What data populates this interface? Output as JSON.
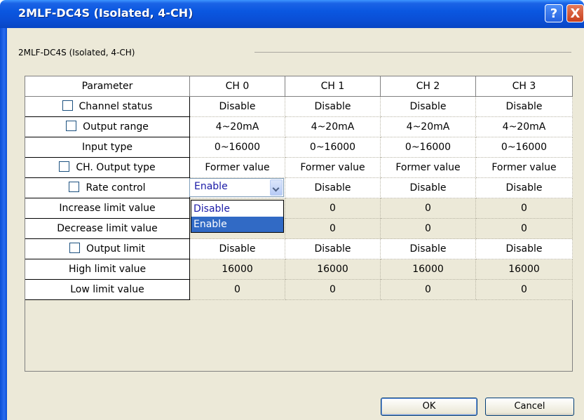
{
  "window": {
    "title": "2MLF-DC4S (Isolated, 4-CH)"
  },
  "title_buttons": {
    "help": "?",
    "close": "X"
  },
  "group": {
    "label": "2MLF-DC4S (Isolated, 4-CH)"
  },
  "table": {
    "headers": [
      "Parameter",
      "CH 0",
      "CH 1",
      "CH 2",
      "CH 3"
    ],
    "rows": [
      {
        "label": "Channel status",
        "checkbox": true,
        "values": [
          "Disable",
          "Disable",
          "Disable",
          "Disable"
        ]
      },
      {
        "label": "Output range",
        "checkbox": true,
        "values": [
          "4~20mA",
          "4~20mA",
          "4~20mA",
          "4~20mA"
        ]
      },
      {
        "label": "Input type",
        "checkbox": false,
        "values": [
          "0~16000",
          "0~16000",
          "0~16000",
          "0~16000"
        ]
      },
      {
        "label": "CH. Output type",
        "checkbox": true,
        "values": [
          "Former value",
          "Former value",
          "Former value",
          "Former value"
        ]
      },
      {
        "label": "Rate control",
        "checkbox": true,
        "values": [
          "Enable",
          "Disable",
          "Disable",
          "Disable"
        ]
      },
      {
        "label": "Increase limit value",
        "checkbox": false,
        "values": [
          "",
          "0",
          "0",
          "0"
        ]
      },
      {
        "label": "Decrease limit value",
        "checkbox": false,
        "values": [
          "",
          "0",
          "0",
          "0"
        ]
      },
      {
        "label": "Output limit",
        "checkbox": true,
        "values": [
          "Disable",
          "Disable",
          "Disable",
          "Disable"
        ]
      },
      {
        "label": "High limit value",
        "checkbox": false,
        "values": [
          "16000",
          "16000",
          "16000",
          "16000"
        ]
      },
      {
        "label": "Low limit value",
        "checkbox": false,
        "values": [
          "0",
          "0",
          "0",
          "0"
        ]
      }
    ]
  },
  "dropdown": {
    "selected": "Enable",
    "options": [
      "Disable",
      "Enable"
    ],
    "highlighted": "Enable"
  },
  "buttons": {
    "ok": "OK",
    "cancel": "Cancel"
  }
}
